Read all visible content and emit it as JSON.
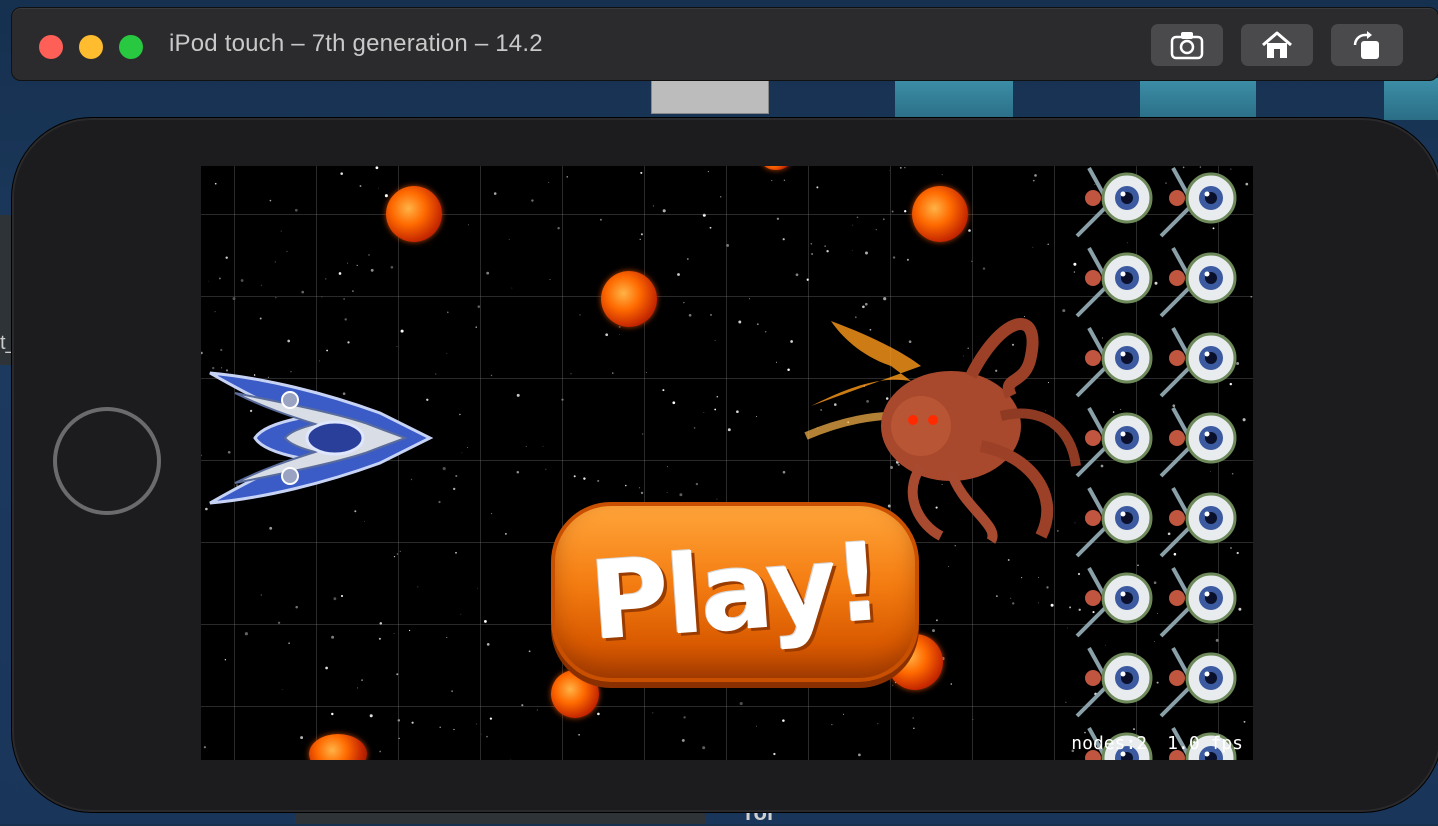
{
  "window": {
    "title": "iPod touch – 7th generation – 14.2",
    "toolbar": [
      {
        "name": "screenshot",
        "icon": "camera-icon"
      },
      {
        "name": "home",
        "icon": "home-icon"
      },
      {
        "name": "rotate",
        "icon": "rotate-icon"
      }
    ]
  },
  "game": {
    "play_label": "Play!",
    "nodes_label": "nodes:2",
    "fps_label": "1.0 fps"
  },
  "background": {
    "bottom_text": "roi",
    "side_text": "t_"
  },
  "colors": {
    "close": "#fe5f57",
    "minimize": "#febc2e",
    "zoom": "#28c840",
    "play_button": "#f47d12"
  }
}
